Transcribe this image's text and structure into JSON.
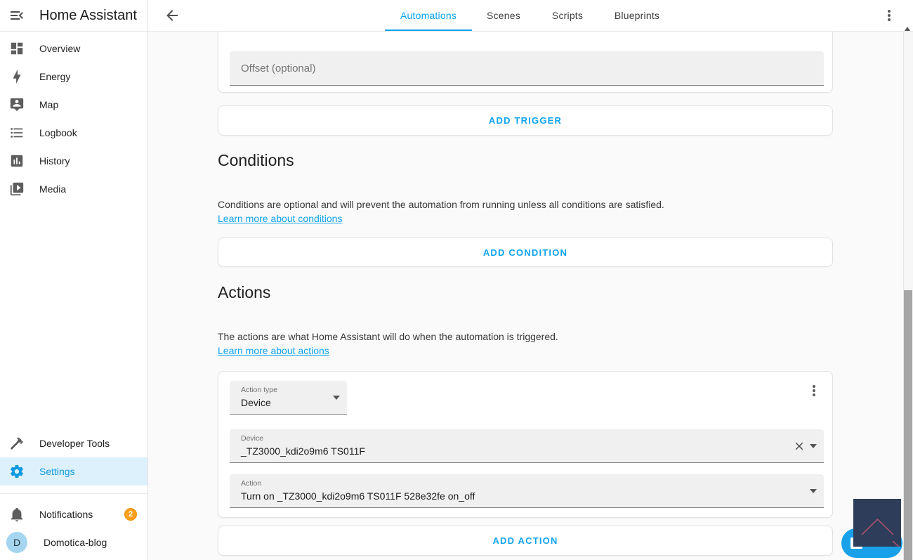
{
  "colors": {
    "accent": "#08a2ef",
    "selected_item_bg": "#ddf1fc",
    "badge_orange": "#faa018",
    "fab_blue": "#18a1e9",
    "overlay_navy": "#2e3e5a",
    "overlay_chevron_pink": "#a8506f",
    "field_bg": "#f0f0f0"
  },
  "sidebar": {
    "title": "Home Assistant",
    "items": [
      {
        "label": "Overview",
        "icon": "view-dashboard-icon"
      },
      {
        "label": "Energy",
        "icon": "lightning-bolt-icon"
      },
      {
        "label": "Map",
        "icon": "account-tooltip-icon"
      },
      {
        "label": "Logbook",
        "icon": "list-bulleted-icon"
      },
      {
        "label": "History",
        "icon": "chart-box-icon"
      },
      {
        "label": "Media",
        "icon": "play-box-icon"
      }
    ],
    "tools": [
      {
        "label": "Developer Tools",
        "icon": "hammer-icon"
      },
      {
        "label": "Settings",
        "icon": "gear-icon",
        "selected": true
      }
    ],
    "footer": [
      {
        "label": "Notifications",
        "icon": "bell-icon",
        "badge": "2"
      },
      {
        "label": "Domotica-blog",
        "avatar": "D"
      }
    ]
  },
  "header": {
    "tabs": [
      {
        "label": "Automations",
        "active": true
      },
      {
        "label": "Scenes",
        "active": false
      },
      {
        "label": "Scripts",
        "active": false
      },
      {
        "label": "Blueprints",
        "active": false
      }
    ]
  },
  "main": {
    "trigger_card": {
      "offset_label": "Offset (optional)"
    },
    "add_trigger": "ADD TRIGGER",
    "conditions": {
      "heading": "Conditions",
      "description": "Conditions are optional and will prevent the automation from running unless all conditions are satisfied.",
      "link": "Learn more about conditions",
      "add_button": "ADD CONDITION"
    },
    "actions": {
      "heading": "Actions",
      "description": "The actions are what Home Assistant will do when the automation is triggered.",
      "link": "Learn more about actions",
      "add_button": "ADD ACTION"
    },
    "action_card": {
      "type_label": "Action type",
      "type_value": "Device",
      "device_label": "Device",
      "device_value": "_TZ3000_kdi2o9m6 TS011F",
      "action_label": "Action",
      "action_value": "Turn on _TZ3000_kdi2o9m6 TS011F 528e32fe on_off"
    }
  }
}
